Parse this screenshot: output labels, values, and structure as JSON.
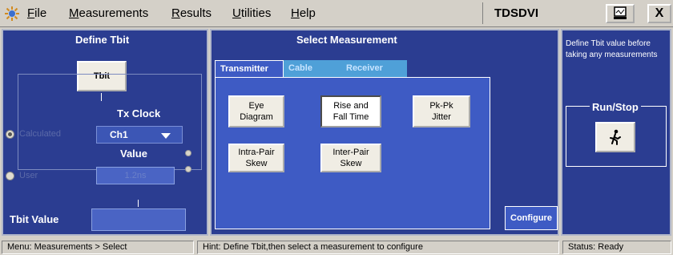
{
  "menubar": {
    "items": [
      {
        "underline": "F",
        "rest": "ile"
      },
      {
        "underline": "M",
        "rest": "easurements"
      },
      {
        "underline": "R",
        "rest": "esults"
      },
      {
        "underline": "U",
        "rest": "tilities"
      },
      {
        "underline": "H",
        "rest": "elp"
      }
    ],
    "app_title": "TDSDVI",
    "close_label": "X"
  },
  "left_pane": {
    "title": "Define Tbit",
    "tbit_button": "Tbit",
    "tx_clock_title": "Tx Clock",
    "calculated_label": "Calculated",
    "channel_value": "Ch1",
    "value_title": "Value",
    "user_label": "User",
    "user_value": "1.2ns",
    "tbit_value_label": "Tbit Value",
    "calculated_selected": true
  },
  "center_pane": {
    "title": "Select Measurement",
    "tabs": [
      "Transmitter",
      "Cable",
      "Receiver"
    ],
    "active_tab": "Transmitter",
    "buttons": {
      "eye_diagram": [
        "Eye",
        "Diagram"
      ],
      "rise_fall": [
        "Rise and",
        "Fall Time"
      ],
      "pkpk_jitter": [
        "Pk-Pk",
        "Jitter"
      ],
      "intra_pair": [
        "Intra-Pair",
        "Skew"
      ],
      "inter_pair": [
        "Inter-Pair",
        "Skew"
      ]
    },
    "selected_measurement": "Rise and Fall Time",
    "configure_label": "Configure"
  },
  "right_pane": {
    "hint": "Define Tbit value before taking any measurements",
    "runstop_title": "Run/Stop",
    "runstop_icon": "running-man-icon"
  },
  "statusbar": {
    "menu_path": "Menu: Measurements > Select",
    "hint": "Hint: Define Tbit,then select a measurement to configure",
    "status": "Status: Ready"
  },
  "colors": {
    "panel_blue": "#2b3d91",
    "tab_blue": "#3e5bc4",
    "inactive_tab": "#4fa0d8",
    "window_gray": "#d4d0c8"
  }
}
